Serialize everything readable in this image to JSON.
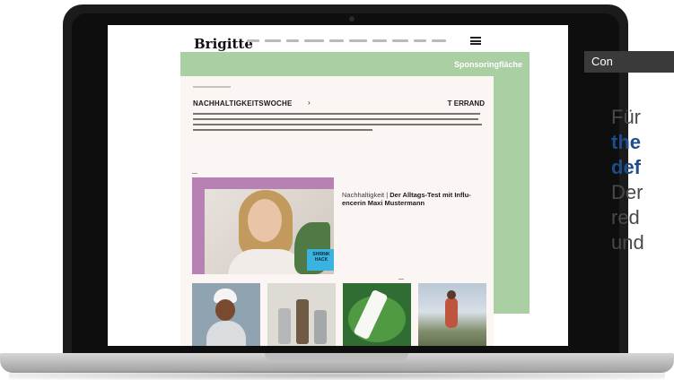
{
  "screen": {
    "logo": "Brigitte",
    "sponsor_label": "Sponsoringfläche",
    "section_title": "NACHHALTIGKEITSWOCHE",
    "section_chevron": "›",
    "brand_tag": "T ERRAND",
    "hero": {
      "badge": "SHRINK HACK",
      "kicker": "Nachhaltigkeit | ",
      "title": "Der Alltags-Test mit Influ-encerin Maxi Mustermann"
    }
  },
  "right_panel": {
    "bar_label": "Con",
    "lines": [
      {
        "text": "Für",
        "bold": false
      },
      {
        "text": "the",
        "bold": true
      },
      {
        "text": "def",
        "bold": true
      },
      {
        "text": "Der",
        "bold": false
      },
      {
        "text": "red",
        "bold": false
      },
      {
        "text": "und",
        "bold": false
      }
    ]
  },
  "colors": {
    "sponsor_green": "#a9cfa3",
    "page_background": "#fbf6f3",
    "hero_background": "#b881b3",
    "accent_blue": "#1d4d8a"
  }
}
